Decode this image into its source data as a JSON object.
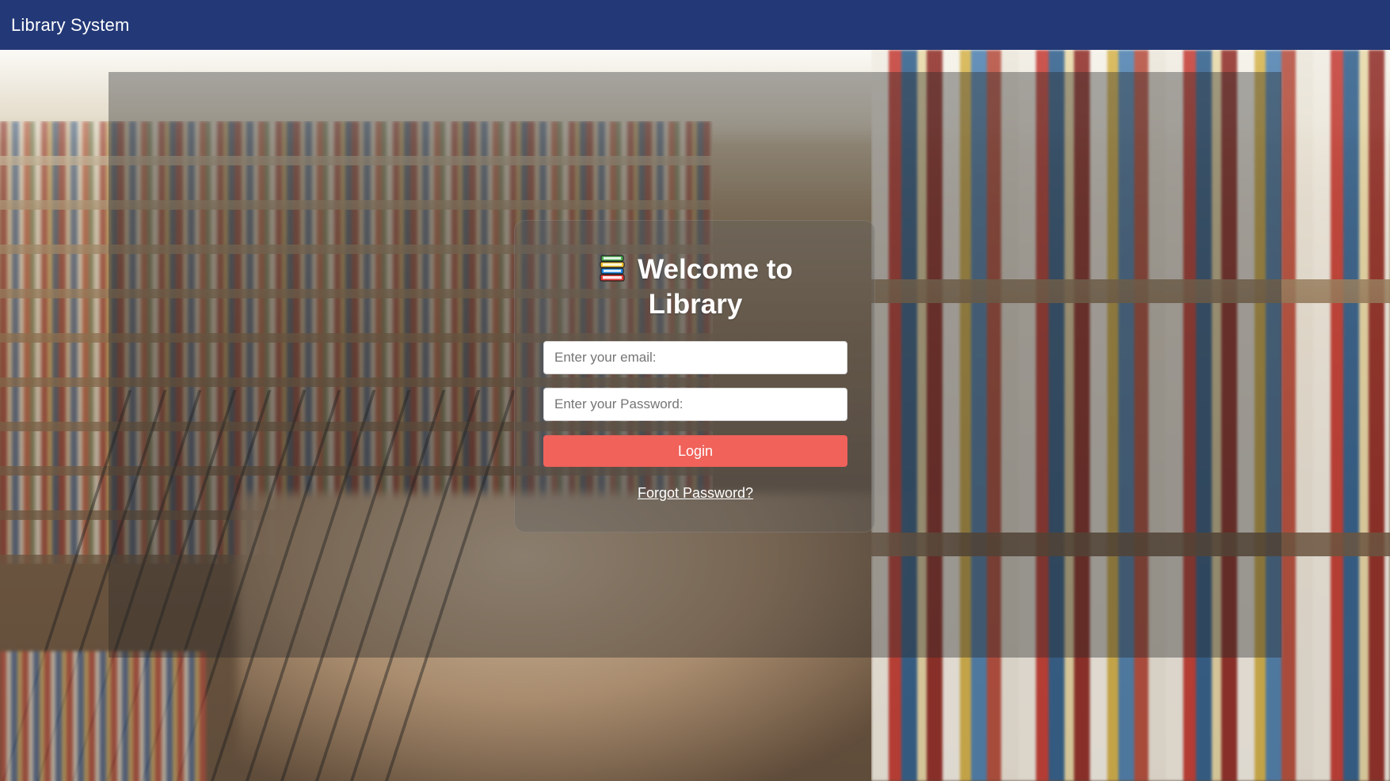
{
  "navbar": {
    "brand": "Library System",
    "background_color": "#233876"
  },
  "background": {
    "image": "library bookshelves photo"
  },
  "login": {
    "title_line1": "Welcome to",
    "title_line2": "Library",
    "title_icon": "books-icon",
    "email_placeholder": "Enter your email:",
    "email_value": "",
    "password_placeholder": "Enter your Password:",
    "password_value": "",
    "login_label": "Login",
    "login_button_color": "#f0625a",
    "forgot_password_label": "Forgot Password?"
  }
}
